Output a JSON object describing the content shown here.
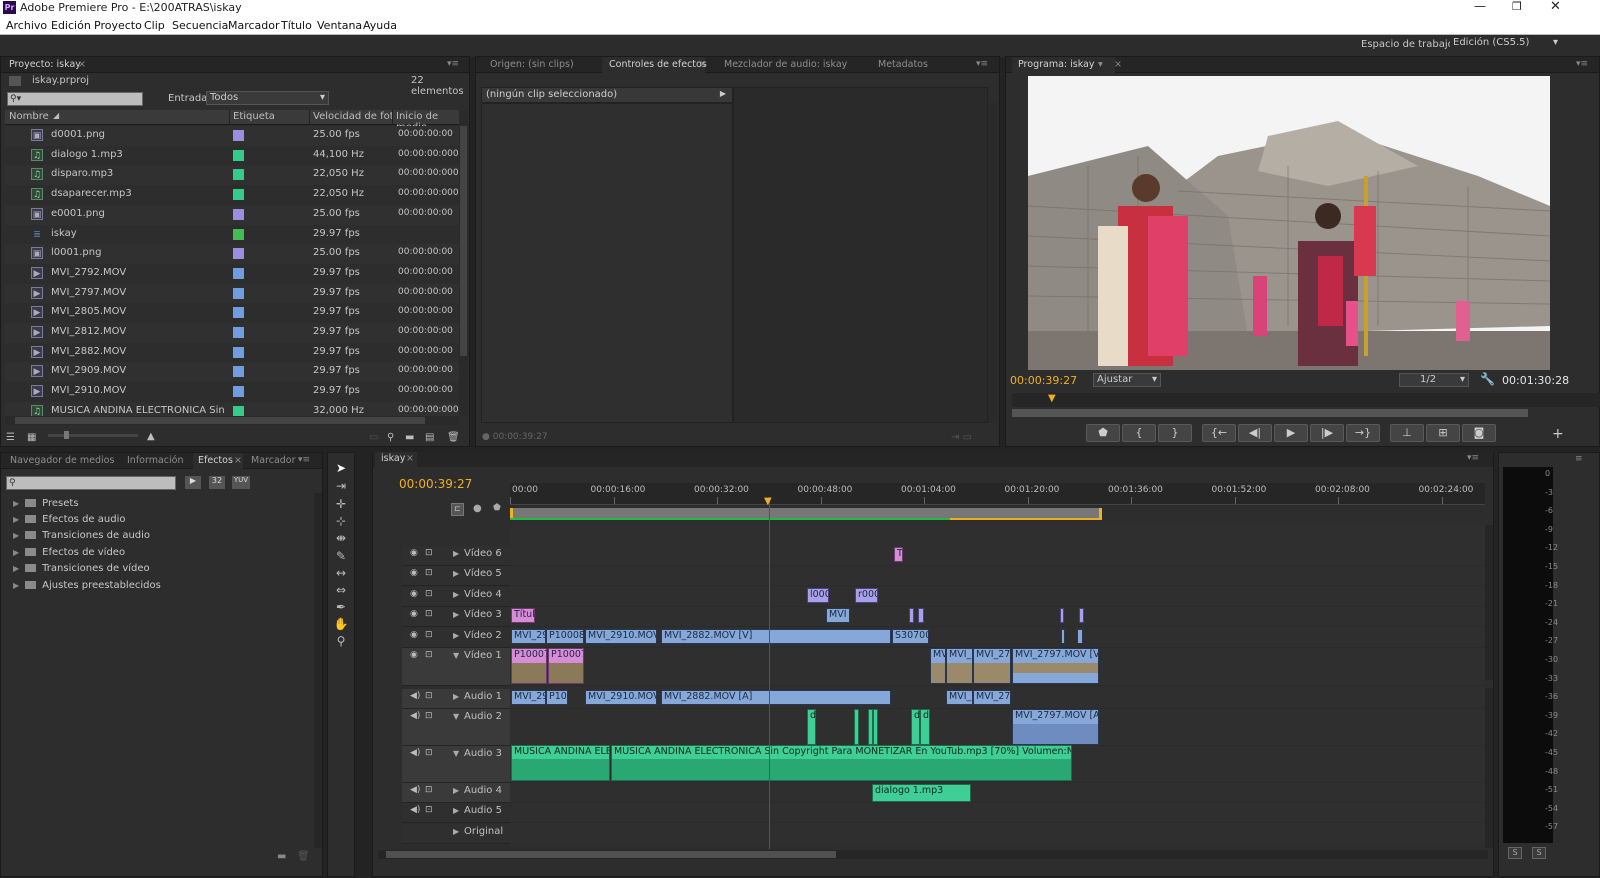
{
  "app": {
    "title": "Adobe Premiere Pro - E:\\200ATRAS\\iskay",
    "icon": "Pr"
  },
  "menu": [
    "Archivo",
    "Edición",
    "Proyecto",
    "Clip",
    "Secuencia",
    "Marcador",
    "Título",
    "Ventana",
    "Ayuda"
  ],
  "workspace": {
    "label": "Espacio de trabajo:",
    "value": "Edición (CS5.5)"
  },
  "project": {
    "tab": "Proyecto: iskay",
    "file": "iskay.prproj",
    "count": "22 elementos",
    "filter_label": "Entrada:",
    "filter_value": "Todos",
    "columns": [
      "Nombre",
      "Etiqueta",
      "Velocidad de fotog",
      "Inicio de medio"
    ],
    "items": [
      {
        "name": "d0001.png",
        "type": "image",
        "color": "#9b8ee0",
        "rate": "25.00 fps",
        "start": "00:00:00:00"
      },
      {
        "name": "dialogo 1.mp3",
        "type": "audio",
        "color": "#33cc88",
        "rate": "44,100 Hz",
        "start": "00:00:00:0000"
      },
      {
        "name": "disparo.mp3",
        "type": "audio",
        "color": "#33cc88",
        "rate": "22,050 Hz",
        "start": "00:00:00:0000"
      },
      {
        "name": "dsaparecer.mp3",
        "type": "audio",
        "color": "#33cc88",
        "rate": "22,050 Hz",
        "start": "00:00:00:0000"
      },
      {
        "name": "e0001.png",
        "type": "image",
        "color": "#9b8ee0",
        "rate": "25.00 fps",
        "start": "00:00:00:00"
      },
      {
        "name": "iskay",
        "type": "sequence",
        "color": "#44bb55",
        "rate": "29.97 fps",
        "start": ""
      },
      {
        "name": "l0001.png",
        "type": "image",
        "color": "#9b8ee0",
        "rate": "25.00 fps",
        "start": "00:00:00:00"
      },
      {
        "name": "MVI_2792.MOV",
        "type": "video",
        "color": "#6f9de0",
        "rate": "29.97 fps",
        "start": "00:00:00:00"
      },
      {
        "name": "MVI_2797.MOV",
        "type": "video",
        "color": "#6f9de0",
        "rate": "29.97 fps",
        "start": "00:00:00:00"
      },
      {
        "name": "MVI_2805.MOV",
        "type": "video",
        "color": "#6f9de0",
        "rate": "29.97 fps",
        "start": "00:00:00:00"
      },
      {
        "name": "MVI_2812.MOV",
        "type": "video",
        "color": "#6f9de0",
        "rate": "29.97 fps",
        "start": "00:00:00:00"
      },
      {
        "name": "MVI_2882.MOV",
        "type": "video",
        "color": "#6f9de0",
        "rate": "29.97 fps",
        "start": "00:00:00:00"
      },
      {
        "name": "MVI_2909.MOV",
        "type": "video",
        "color": "#6f9de0",
        "rate": "29.97 fps",
        "start": "00:00:00:00"
      },
      {
        "name": "MVI_2910.MOV",
        "type": "video",
        "color": "#6f9de0",
        "rate": "29.97 fps",
        "start": "00:00:00:00"
      },
      {
        "name": "MÚSICA ANDINA ELECTRÓNICA Sin Cop:",
        "type": "audio",
        "color": "#33cc88",
        "rate": "32,000 Hz",
        "start": "00:00:00:0000"
      }
    ]
  },
  "source_tabs": [
    "Origen: (sin clips)",
    "Controles de efectos",
    "Mezclador de audio: iskay",
    "Metadatos"
  ],
  "effect_controls": {
    "empty": "(ningún clip seleccionado)",
    "timecode": "00:00:39:27"
  },
  "program": {
    "tab": "Programa: iskay",
    "timecode": "00:00:39:27",
    "fit": "Ajustar",
    "resolution": "1/2",
    "duration": "00:01:30:28"
  },
  "browser": {
    "tabs": [
      "Navegador de medios",
      "Información",
      "Efectos",
      "Marcador"
    ],
    "folders": [
      "Presets",
      "Efectos de audio",
      "Transiciones de audio",
      "Efectos de vídeo",
      "Transiciones de vídeo",
      "Ajustes preestablecidos"
    ],
    "badges": [
      "32",
      "YUV"
    ]
  },
  "timeline": {
    "tab": "iskay",
    "timecode": "00:00:39:27",
    "ruler": [
      "00:00",
      "00:00:16:00",
      "00:00:32:00",
      "00:00:48:00",
      "00:01:04:00",
      "00:01:20:00",
      "00:01:36:00",
      "00:01:52:00",
      "00:02:08:00",
      "00:02:24:00"
    ],
    "tracks": [
      "Vídeo 6",
      "Vídeo 5",
      "Vídeo 4",
      "Vídeo 3",
      "Vídeo 2",
      "Vídeo 1",
      "Audio 1",
      "Audio 2",
      "Audio 3",
      "Audio 4",
      "Audio 5",
      "Original"
    ],
    "clips": {
      "v6_a": "T",
      "v4_a": "l000",
      "v4_b": "r000",
      "v3_a": "Títul",
      "v3_b": "MVI",
      "v2_a": "MVI_29",
      "v2_b": "P100087",
      "v2_c": "MVI_2910.MOV",
      "v2_d": "MVI_2882.MOV [V]",
      "v2_e": "S307001",
      "v1_a": "P100078",
      "v1_b": "P100078",
      "v1_c": "MV",
      "v1_d": "MVI_",
      "v1_e": "MVI_279",
      "v1_f": "MVI_2797.MOV [V]",
      "a1_a": "MVI_29",
      "a1_b": "P10",
      "a1_c": "MVI_2910.MOV [",
      "a1_d": "MVI_2882.MOV [A]",
      "a1_e": "MVI_",
      "a1_f": "MVI_279",
      "a2_a": "MVI_2797.MOV [A]",
      "a2_s1": "d",
      "a2_s2": "d",
      "a2_s3": "d",
      "a3_a": "MÚSICA ANDINA ELEC",
      "a3_b": "MÚSICA ANDINA ELECTRÓNICA Sin Copyright Para MONETIZAR En YouTub.mp3 [70%]  Volumen:Nivel ▾",
      "a4_a": "dialogo 1.mp3"
    }
  },
  "meter_scale": [
    "0",
    "-3",
    "-6",
    "-9",
    "-12",
    "-15",
    "-18",
    "-21",
    "-24",
    "-27",
    "-30",
    "-33",
    "-36",
    "-39",
    "-42",
    "-45",
    "-48",
    "-51",
    "-54",
    "-57"
  ],
  "meter_buttons": [
    "S",
    "S"
  ]
}
